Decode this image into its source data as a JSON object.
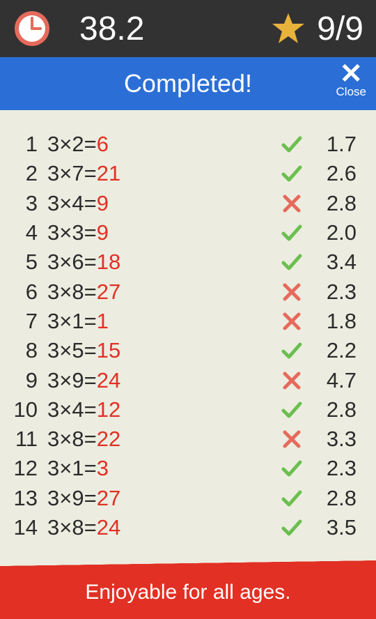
{
  "topbar": {
    "time": "38.2",
    "score": "9/9"
  },
  "bluebar": {
    "title": "Completed!",
    "close_label": "Close"
  },
  "results": [
    {
      "n": "1",
      "expr": "3×2=",
      "answer": "6",
      "correct": true,
      "t": "1.7"
    },
    {
      "n": "2",
      "expr": "3×7=",
      "answer": "21",
      "correct": true,
      "t": "2.6"
    },
    {
      "n": "3",
      "expr": "3×4=",
      "answer": "9",
      "correct": false,
      "t": "2.8"
    },
    {
      "n": "4",
      "expr": "3×3=",
      "answer": "9",
      "correct": true,
      "t": "2.0"
    },
    {
      "n": "5",
      "expr": "3×6=",
      "answer": "18",
      "correct": true,
      "t": "3.4"
    },
    {
      "n": "6",
      "expr": "3×8=",
      "answer": "27",
      "correct": false,
      "t": "2.3"
    },
    {
      "n": "7",
      "expr": "3×1=",
      "answer": "1",
      "correct": false,
      "t": "1.8"
    },
    {
      "n": "8",
      "expr": "3×5=",
      "answer": "15",
      "correct": true,
      "t": "2.2"
    },
    {
      "n": "9",
      "expr": "3×9=",
      "answer": "24",
      "correct": false,
      "t": "4.7"
    },
    {
      "n": "10",
      "expr": "3×4=",
      "answer": "12",
      "correct": true,
      "t": "2.8"
    },
    {
      "n": "11",
      "expr": "3×8=",
      "answer": "22",
      "correct": false,
      "t": "3.3"
    },
    {
      "n": "12",
      "expr": "3×1=",
      "answer": "3",
      "correct": true,
      "t": "2.3"
    },
    {
      "n": "13",
      "expr": "3×9=",
      "answer": "27",
      "correct": true,
      "t": "2.8"
    },
    {
      "n": "14",
      "expr": "3×8=",
      "answer": "24",
      "correct": true,
      "t": "3.5"
    }
  ],
  "footer": {
    "text": "Enjoyable for all ages."
  },
  "colors": {
    "answer": "#e23024",
    "check": "#6bbf4f",
    "cross": "#e66a5c",
    "blue": "#2b6fd6",
    "red": "#e23024",
    "bg": "#ecede0"
  }
}
